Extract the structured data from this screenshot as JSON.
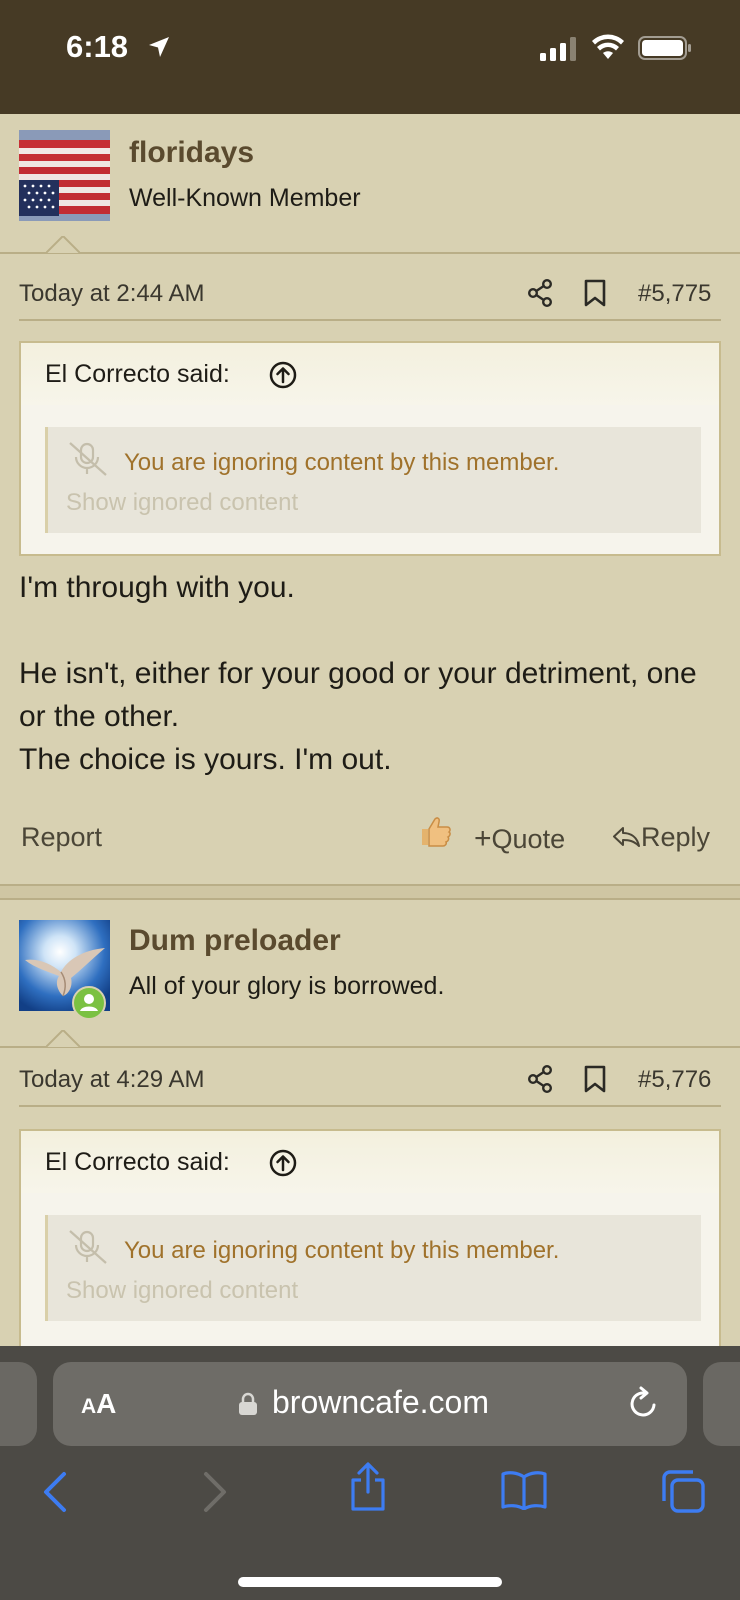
{
  "status": {
    "time": "6:18"
  },
  "posts": [
    {
      "username": "floridays",
      "user_title": "Well-Known Member",
      "date": "Today at 2:44 AM",
      "number": "#5,775",
      "quote_author": "El Correcto said:",
      "ignored_text": "You are ignoring content by this member.",
      "show_ignored": "Show ignored content",
      "body": [
        "I'm through with you.",
        "",
        "He isn't, either for your good or your detriment, one or the other.",
        "The choice is yours. I'm out."
      ],
      "actions": {
        "report": "Report",
        "quote": "Quote",
        "reply": "Reply"
      }
    },
    {
      "username": "Dum preloader",
      "user_title": "All of your glory is borrowed.",
      "date": "Today at 4:29 AM",
      "number": "#5,776",
      "quote_author": "El Correcto said:",
      "ignored_text": "You are ignoring content by this member.",
      "show_ignored": "Show ignored content"
    }
  ],
  "browser": {
    "text_size_label": "AA",
    "url": "browncafe.com"
  },
  "colors": {
    "page_bg": "#d8d1b2",
    "status_bar_bg": "#463a25",
    "ignored_text": "#a0722b",
    "username": "#5a4a2e",
    "safari_blue": "#3d7cf2"
  }
}
